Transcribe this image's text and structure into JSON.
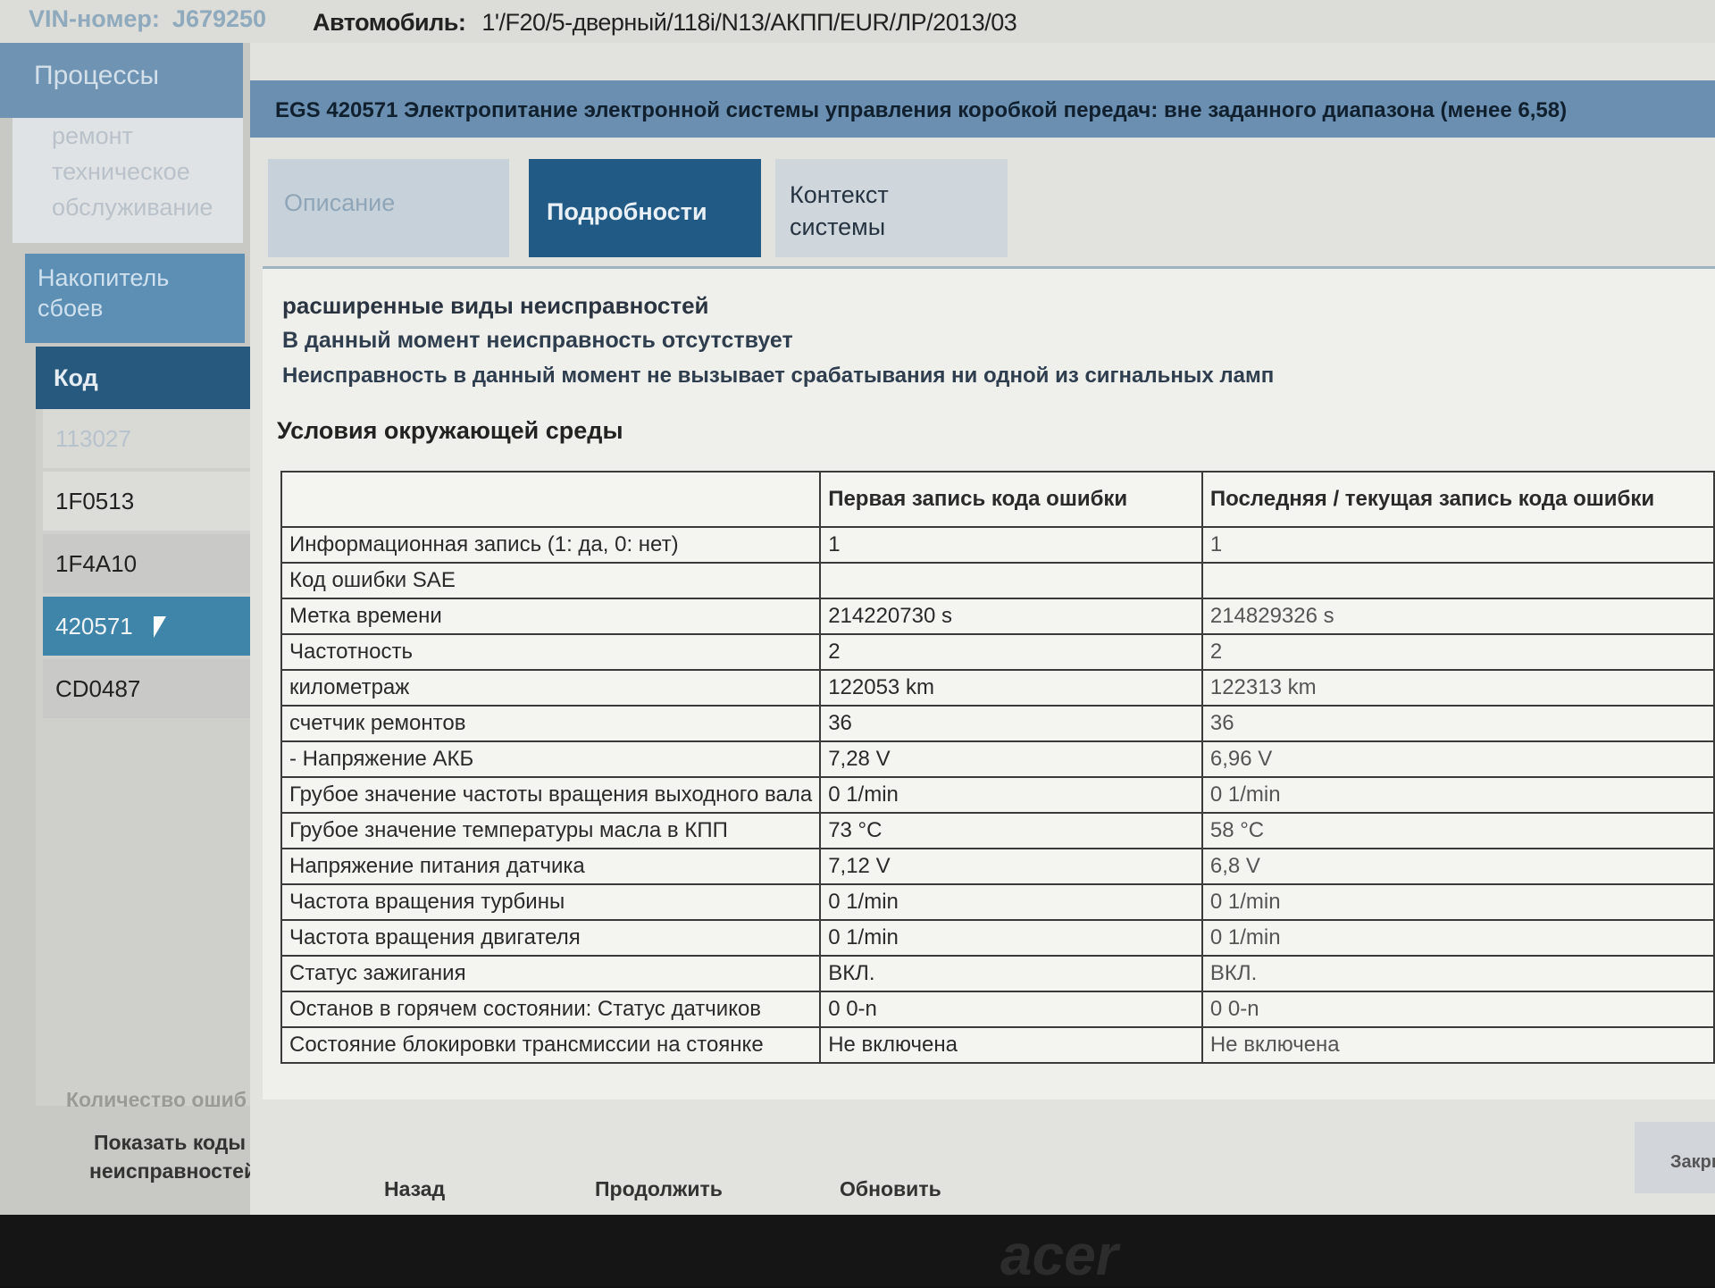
{
  "header": {
    "vin_label": "VIN-номер:",
    "vin_value": "J679250",
    "car_label": "Автомобиль:",
    "car_value": "1'/F20/5-дверный/118i/N13/АКПП/EUR/ЛР/2013/03"
  },
  "sidebar": {
    "processes": "Процессы",
    "repair_lines": [
      "ремонт",
      "техническое",
      "обслуживание"
    ],
    "storage_lines": [
      "Накопитель",
      "сбоев"
    ],
    "code_header": "Код",
    "codes": [
      "113027",
      "1F0513",
      "1F4A10",
      "420571",
      "CD0487"
    ],
    "selected_code": "420571",
    "error_count_label": "Количество ошиб",
    "show_codes_label": "Показать коды неисправностей"
  },
  "fault": {
    "title": "ЕGS 420571 Электропитание электронной системы управления коробкой передач: вне заданного диапазона (менее 6,58)"
  },
  "tabs": {
    "description": "Описание",
    "details": "Подробности",
    "context_line1": "Контекст",
    "context_line2": "системы"
  },
  "details": {
    "extended_title": "расширенные виды неисправностей",
    "line1": "В данный момент неисправность отсутствует",
    "line2": "Неисправность в данный момент не вызывает срабатывания ни одной из сигнальных ламп",
    "env_title": "Условия окружающей среды"
  },
  "table": {
    "col_first": "Первая запись кода ошибки",
    "col_last": "Последняя / текущая запись кода ошибки",
    "rows": [
      {
        "label": "Информационная запись (1: да, 0: нет)",
        "first": "1",
        "last": "1"
      },
      {
        "label": "Код ошибки SAE",
        "first": "",
        "last": ""
      },
      {
        "label": "Метка времени",
        "first": "214220730 s",
        "last": "214829326 s"
      },
      {
        "label": "Частотность",
        "first": "2",
        "last": "2"
      },
      {
        "label": "километраж",
        "first": "122053 km",
        "last": "122313 km"
      },
      {
        "label": "счетчик ремонтов",
        "first": "36",
        "last": "36"
      },
      {
        "label": "- Напряжение АКБ",
        "first": "7,28 V",
        "last": "6,96 V"
      },
      {
        "label": "Грубое значение частоты вращения выходного вала",
        "first": "0 1/min",
        "last": "0 1/min"
      },
      {
        "label": "Грубое значение температуры масла в КПП",
        "first": "73 °C",
        "last": "58 °C"
      },
      {
        "label": "Напряжение питания датчика",
        "first": "7,12 V",
        "last": "6,8 V"
      },
      {
        "label": "Частота вращения турбины",
        "first": "0 1/min",
        "last": "0 1/min"
      },
      {
        "label": "Частота вращения двигателя",
        "first": "0 1/min",
        "last": "0 1/min"
      },
      {
        "label": "Статус зажигания",
        "first": "ВКЛ.",
        "last": "ВКЛ."
      },
      {
        "label": "Останов в горячем состоянии: Статус датчиков",
        "first": "0 0-n",
        "last": "0 0-n"
      },
      {
        "label": "Состояние блокировки трансмиссии на стоянке",
        "first": "Не включена",
        "last": "Не включена"
      }
    ]
  },
  "footer": {
    "back": "Назад",
    "continue": "Продолжить",
    "refresh": "Обновить",
    "close": "Закрыть"
  },
  "bezel": {
    "logo": "acer"
  },
  "colors": {
    "selected": "#3f85a9",
    "tab_active": "#215a85",
    "title_bar": "#6a8fb0"
  }
}
